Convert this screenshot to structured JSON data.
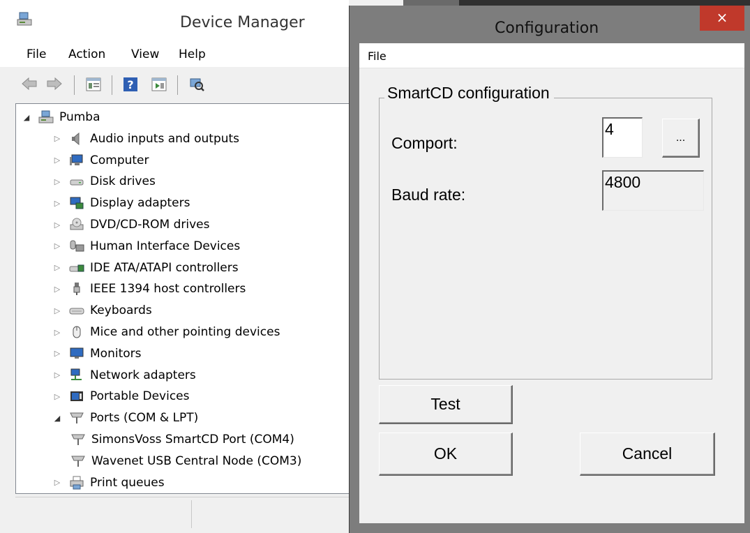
{
  "device_manager": {
    "title": "Device Manager",
    "menu": [
      "File",
      "Action",
      "View",
      "Help"
    ],
    "toolbar_icons": [
      "back-icon",
      "forward-icon",
      "properties-icon",
      "help-icon",
      "update-driver-icon",
      "scan-hardware-icon"
    ],
    "tree": [
      {
        "label": "Pumba",
        "expanded": true,
        "level": 0,
        "icon": "computer-root-icon"
      },
      {
        "label": "Audio inputs and outputs",
        "level": 1,
        "icon": "speaker-icon"
      },
      {
        "label": "Computer",
        "level": 1,
        "icon": "computer-icon"
      },
      {
        "label": "Disk drives",
        "level": 1,
        "icon": "disk-drive-icon"
      },
      {
        "label": "Display adapters",
        "level": 1,
        "icon": "display-adapter-icon"
      },
      {
        "label": "DVD/CD-ROM drives",
        "level": 1,
        "icon": "dvd-drive-icon"
      },
      {
        "label": "Human Interface Devices",
        "level": 1,
        "icon": "hid-icon"
      },
      {
        "label": "IDE ATA/ATAPI controllers",
        "level": 1,
        "icon": "ide-controller-icon"
      },
      {
        "label": "IEEE 1394 host controllers",
        "level": 1,
        "icon": "firewire-icon"
      },
      {
        "label": "Keyboards",
        "level": 1,
        "icon": "keyboard-icon"
      },
      {
        "label": "Mice and other pointing devices",
        "level": 1,
        "icon": "mouse-icon"
      },
      {
        "label": "Monitors",
        "level": 1,
        "icon": "monitor-icon"
      },
      {
        "label": "Network adapters",
        "level": 1,
        "icon": "network-adapter-icon"
      },
      {
        "label": "Portable Devices",
        "level": 1,
        "icon": "portable-device-icon"
      },
      {
        "label": "Ports (COM & LPT)",
        "expanded": true,
        "level": 1,
        "icon": "port-icon"
      },
      {
        "label": "SimonsVoss SmartCD Port (COM4)",
        "level": 2,
        "icon": "port-icon"
      },
      {
        "label": "Wavenet USB Central Node (COM3)",
        "level": 2,
        "icon": "port-icon"
      },
      {
        "label": "Print queues",
        "level": 1,
        "icon": "printer-icon"
      }
    ]
  },
  "configuration": {
    "title": "Configuration",
    "close_glyph": "×",
    "menu": [
      "File"
    ],
    "group_title": "SmartCD configuration",
    "comport_label": "Comport:",
    "comport_value": "4",
    "browse_label": "...",
    "baud_label": "Baud rate:",
    "baud_value": "4800",
    "test_label": "Test",
    "ok_label": "OK",
    "cancel_label": "Cancel"
  },
  "colors": {
    "dialog_frame": "#7d7d7d",
    "close_button": "#c0392b",
    "window_bg": "#f0f0f0"
  }
}
